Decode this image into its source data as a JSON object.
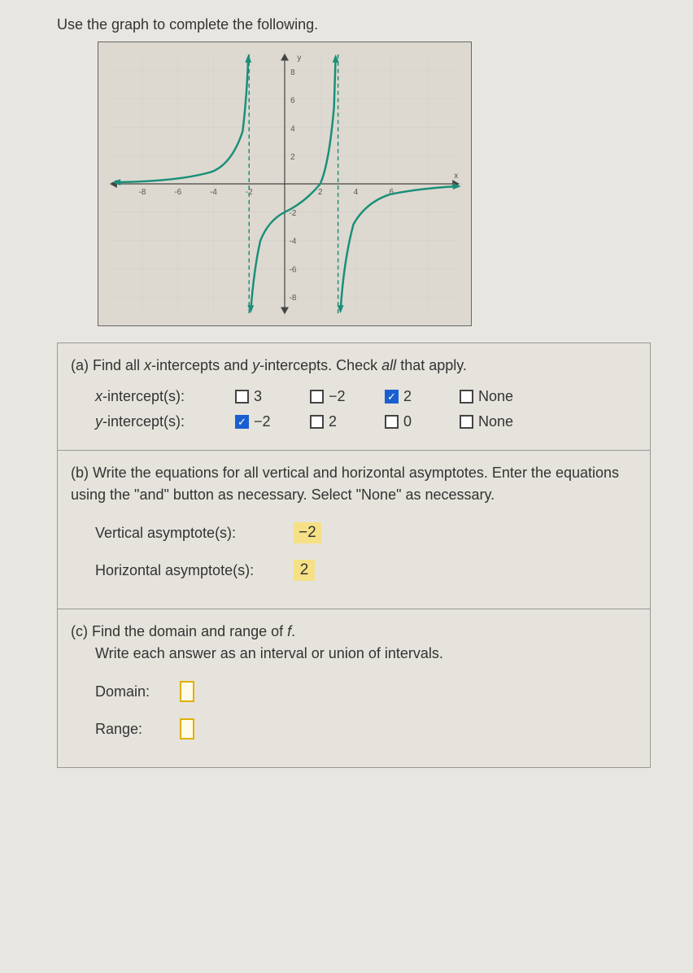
{
  "instruction": "Use the graph to complete the following.",
  "partA": {
    "prompt_before": "(a) Find all ",
    "x": "x",
    "mid1": "-intercepts and ",
    "y": "y",
    "mid2": "-intercepts. Check ",
    "all": "all",
    "after": " that apply.",
    "xrow_label": "x-intercept(s):",
    "yrow_label": "y-intercept(s):",
    "x_opts": [
      "3",
      "−2",
      "2",
      "None"
    ],
    "y_opts": [
      "−2",
      "2",
      "0",
      "None"
    ]
  },
  "partB": {
    "text": "(b) Write the equations for all vertical and horizontal asymptotes. Enter the equations using the \"and\" button as necessary. Select \"None\" as necessary.",
    "v_label": "Vertical asymptote(s):",
    "v_ans": "−2",
    "h_label": "Horizontal asymptote(s):",
    "h_ans": "2"
  },
  "partC": {
    "line1_before": "(c) Find the domain and range of ",
    "f": "f",
    "line1_after": ".",
    "line2": "Write each answer as an interval or union of intervals.",
    "domain_label": "Domain:",
    "range_label": "Range:"
  },
  "chart_data": {
    "type": "line",
    "title": "",
    "xlabel": "x",
    "ylabel": "y",
    "xlim": [
      -9,
      9
    ],
    "ylim": [
      -9,
      9
    ],
    "x_ticks": [
      -8,
      -6,
      -4,
      -2,
      2,
      4,
      6,
      8
    ],
    "y_ticks": [
      -8,
      -6,
      -4,
      -2,
      2,
      4,
      6,
      8
    ],
    "vertical_asymptotes": [
      -2,
      3
    ],
    "horizontal_asymptote": 0,
    "x_intercept": 2,
    "y_intercept": -2,
    "series": [
      {
        "name": "left branch",
        "x": [
          -9,
          -8,
          -7,
          -6,
          -5,
          -4,
          -3,
          -2.5,
          -2.2
        ],
        "y": [
          0.1,
          0.15,
          0.2,
          0.3,
          0.5,
          0.9,
          1.8,
          4,
          8
        ]
      },
      {
        "name": "middle branch",
        "x": [
          -1.8,
          -1.5,
          -1,
          0,
          1,
          2,
          2.5,
          2.8
        ],
        "y": [
          -8,
          -5,
          -3,
          -2,
          -1.2,
          0,
          3,
          8
        ]
      },
      {
        "name": "right branch",
        "x": [
          3.2,
          3.5,
          4,
          5,
          6,
          7,
          8,
          9
        ],
        "y": [
          -8,
          -4,
          -2,
          -1,
          -0.6,
          -0.4,
          -0.3,
          -0.2
        ]
      }
    ]
  }
}
